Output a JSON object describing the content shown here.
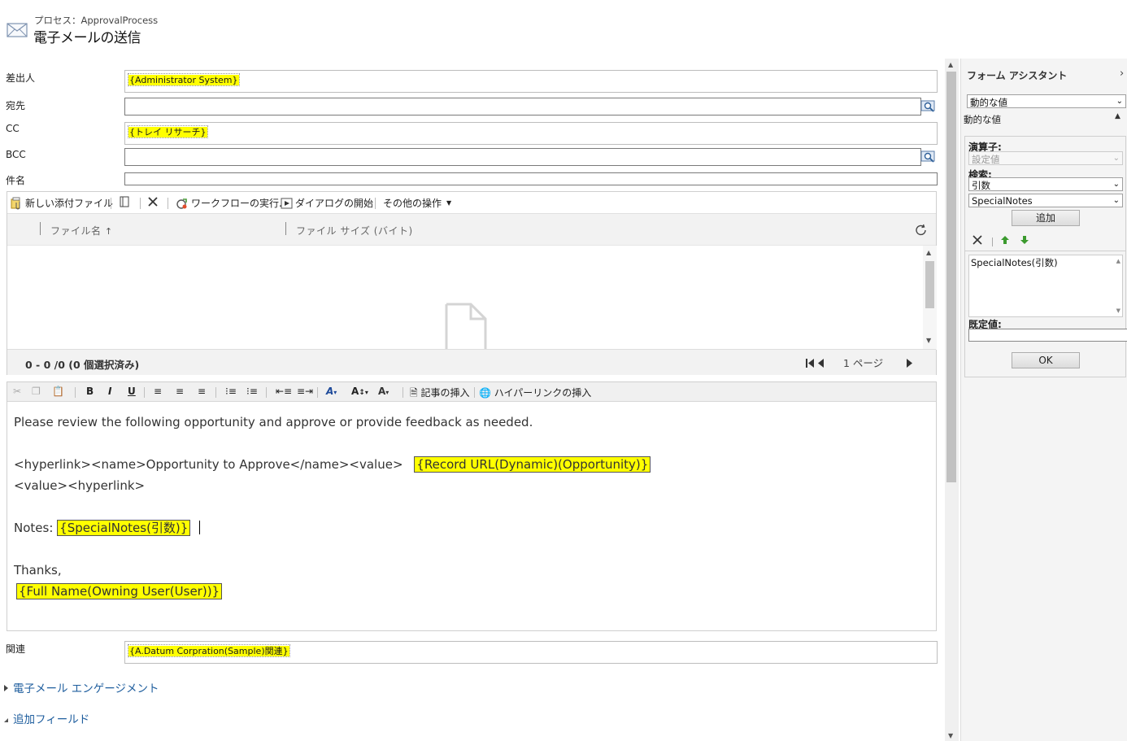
{
  "header": {
    "subtitle": "プロセス：ApprovalProcess",
    "title": "電子メールの送信"
  },
  "form": {
    "from_label": "差出人",
    "from_value": "{Administrator System}",
    "to_label": "宛先",
    "cc_label": "CC",
    "cc_value": "{トレイ リサーチ}",
    "bcc_label": "BCC",
    "subject_label": "件名"
  },
  "attachments": {
    "toolbar": {
      "new_attachment": "新しい添付ファイル",
      "run_workflow": "ワークフローの実行...",
      "start_dialog": "ダイアログの開始",
      "more_actions": "その他の操作"
    },
    "columns": [
      "ファイル名",
      "ファイル サイズ (バイト)"
    ],
    "count_text": "0 - 0 /0 (0 個選択済み)",
    "page_label": "1 ページ"
  },
  "editor": {
    "toolbar": {
      "insert_article": "記事の挿入",
      "insert_hyperlink": "ハイパーリンクの挿入"
    },
    "line1": "Please review the following opportunity and approve or provide feedback as needed.",
    "line2_prefix": "<hyperlink><name>Opportunity to Approve</name><value>",
    "line2_token": "{Record URL(Dynamic)(Opportunity)}",
    "line3": "<value><hyperlink>",
    "notes_prefix": "Notes:",
    "notes_token": "{SpecialNotes(引数)}",
    "thanks": "Thanks,",
    "signature_token": "{Full Name(Owning User(User))}"
  },
  "related": {
    "label": "関連",
    "value": "{A.Datum Corpration(Sample)関連}"
  },
  "sections": {
    "email_engagement": "電子メール エンゲージメント",
    "additional_fields": "追加フィールド"
  },
  "panel": {
    "title": "フォーム アシスタント",
    "dynamic_select": "動的な値",
    "dynamic_header": "動的な値",
    "operator_label": "演算子:",
    "operator_value": "設定値",
    "search_label": "検索:",
    "search_value": "引数",
    "field_value": "SpecialNotes",
    "add_button": "追加",
    "list_item": "SpecialNotes(引数)",
    "default_label": "既定値:",
    "ok_button": "OK"
  },
  "colors": {
    "highlight": "#ffff00",
    "link": "#1f5e9e",
    "panel_bg": "#f4f4f4"
  }
}
